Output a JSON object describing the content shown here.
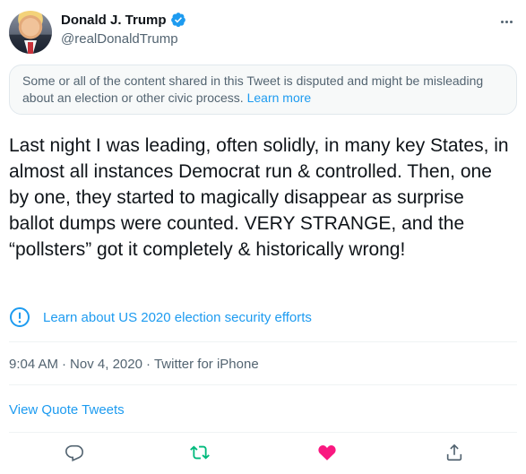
{
  "user": {
    "display_name": "Donald J. Trump",
    "handle": "@realDonaldTrump",
    "verified": true
  },
  "notice": {
    "text": "Some or all of the content shared in this Tweet is disputed and might be misleading about an election or other civic process.",
    "link_label": "Learn more"
  },
  "tweet": {
    "text": "Last night I was leading, often solidly, in many key States, in almost all instances Democrat run & controlled. Then, one by one, they started to magically disappear as surprise ballot dumps were counted. VERY STRANGE, and the “pollsters” got it completely & historically wrong!"
  },
  "election_link": {
    "label": "Learn about US 2020 election security efforts",
    "icon": "exclamation-circle-icon"
  },
  "meta": {
    "time": "9:04 AM",
    "separator": "·",
    "date": "Nov 4, 2020",
    "source": "Twitter for iPhone"
  },
  "quote_tweets_label": "View Quote Tweets",
  "actions": {
    "reply_icon": "reply-icon",
    "retweet_icon": "retweet-icon",
    "like_icon": "heart-icon",
    "share_icon": "share-icon",
    "retweet_active": true,
    "liked": true
  },
  "colors": {
    "accent": "#1d9bf0",
    "retweet_green": "#00ba7c",
    "like_red": "#f91880",
    "secondary_text": "#536471"
  }
}
